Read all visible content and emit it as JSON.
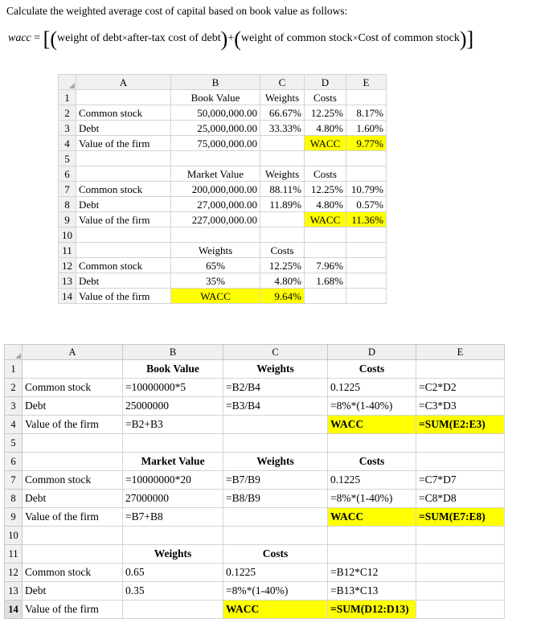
{
  "intro": {
    "text": "Calculate the weighted average cost of capital based on book value as follows:"
  },
  "formula": {
    "lhs": "wacc",
    "equals": "=",
    "part1": "weight of debt",
    "op1": "×",
    "part2": "after-tax cost of debt",
    "plus": "+",
    "part3": "weight of common stock",
    "op2": "×",
    "part4": "Cost of common stock"
  },
  "sheet1": {
    "columns": [
      "A",
      "B",
      "C",
      "D",
      "E"
    ],
    "rows": [
      {
        "n": "1",
        "cells": [
          "",
          "Book Value",
          "Weights",
          "Costs",
          ""
        ]
      },
      {
        "n": "2",
        "cells": [
          "Common stock",
          "50,000,000.00",
          "66.67%",
          "12.25%",
          "8.17%"
        ]
      },
      {
        "n": "3",
        "cells": [
          "Debt",
          "25,000,000.00",
          "33.33%",
          "4.80%",
          "1.60%"
        ]
      },
      {
        "n": "4",
        "cells": [
          "Value of the firm",
          "75,000,000.00",
          "",
          "WACC",
          "9.77%"
        ]
      },
      {
        "n": "5",
        "cells": [
          "",
          "",
          "",
          "",
          ""
        ]
      },
      {
        "n": "6",
        "cells": [
          "",
          "Market Value",
          "Weights",
          "Costs",
          ""
        ]
      },
      {
        "n": "7",
        "cells": [
          "Common stock",
          "200,000,000.00",
          "88.11%",
          "12.25%",
          "10.79%"
        ]
      },
      {
        "n": "8",
        "cells": [
          "Debt",
          "27,000,000.00",
          "11.89%",
          "4.80%",
          "0.57%"
        ]
      },
      {
        "n": "9",
        "cells": [
          "Value of the firm",
          "227,000,000.00",
          "",
          "WACC",
          "11.36%"
        ]
      },
      {
        "n": "10",
        "cells": [
          "",
          "",
          "",
          "",
          ""
        ]
      },
      {
        "n": "11",
        "cells": [
          "",
          "Weights",
          "Costs",
          "",
          ""
        ]
      },
      {
        "n": "12",
        "cells": [
          "Common stock",
          "65%",
          "12.25%",
          "7.96%",
          ""
        ]
      },
      {
        "n": "13",
        "cells": [
          "Debt",
          "35%",
          "4.80%",
          "1.68%",
          ""
        ]
      },
      {
        "n": "14",
        "cells": [
          "Value of the firm",
          "WACC",
          "9.64%",
          "",
          ""
        ]
      }
    ]
  },
  "sheet2": {
    "columns": [
      "A",
      "B",
      "C",
      "D",
      "E"
    ],
    "rows": [
      {
        "n": "1",
        "cells": [
          "",
          "Book Value",
          "Weights",
          "Costs",
          ""
        ]
      },
      {
        "n": "2",
        "cells": [
          "Common stock",
          "=10000000*5",
          "=B2/B4",
          "0.1225",
          "=C2*D2"
        ]
      },
      {
        "n": "3",
        "cells": [
          "Debt",
          "25000000",
          "=B3/B4",
          "=8%*(1-40%)",
          "=C3*D3"
        ]
      },
      {
        "n": "4",
        "cells": [
          "Value of the firm",
          "=B2+B3",
          "",
          "WACC",
          "=SUM(E2:E3)"
        ]
      },
      {
        "n": "5",
        "cells": [
          "",
          "",
          "",
          "",
          ""
        ]
      },
      {
        "n": "6",
        "cells": [
          "",
          "Market Value",
          "Weights",
          "Costs",
          ""
        ]
      },
      {
        "n": "7",
        "cells": [
          "Common stock",
          "=10000000*20",
          "=B7/B9",
          "0.1225",
          "=C7*D7"
        ]
      },
      {
        "n": "8",
        "cells": [
          "Debt",
          "27000000",
          "=B8/B9",
          "=8%*(1-40%)",
          "=C8*D8"
        ]
      },
      {
        "n": "9",
        "cells": [
          "Value of the firm",
          "=B7+B8",
          "",
          "WACC",
          "=SUM(E7:E8)"
        ]
      },
      {
        "n": "10",
        "cells": [
          "",
          "",
          "",
          "",
          ""
        ]
      },
      {
        "n": "11",
        "cells": [
          "",
          "Weights",
          "Costs",
          "",
          ""
        ]
      },
      {
        "n": "12",
        "cells": [
          "Common stock",
          "0.65",
          "0.1225",
          "=B12*C12",
          ""
        ]
      },
      {
        "n": "13",
        "cells": [
          "Debt",
          "0.35",
          "=8%*(1-40%)",
          "=B13*C13",
          ""
        ]
      },
      {
        "n": "14",
        "cells": [
          "Value of the firm",
          "",
          "WACC",
          "=SUM(D12:D13)",
          ""
        ]
      }
    ]
  },
  "colors": {
    "highlight": "#ffff00",
    "header_bg": "#eff0f1",
    "grid": "#d4d4d4"
  }
}
